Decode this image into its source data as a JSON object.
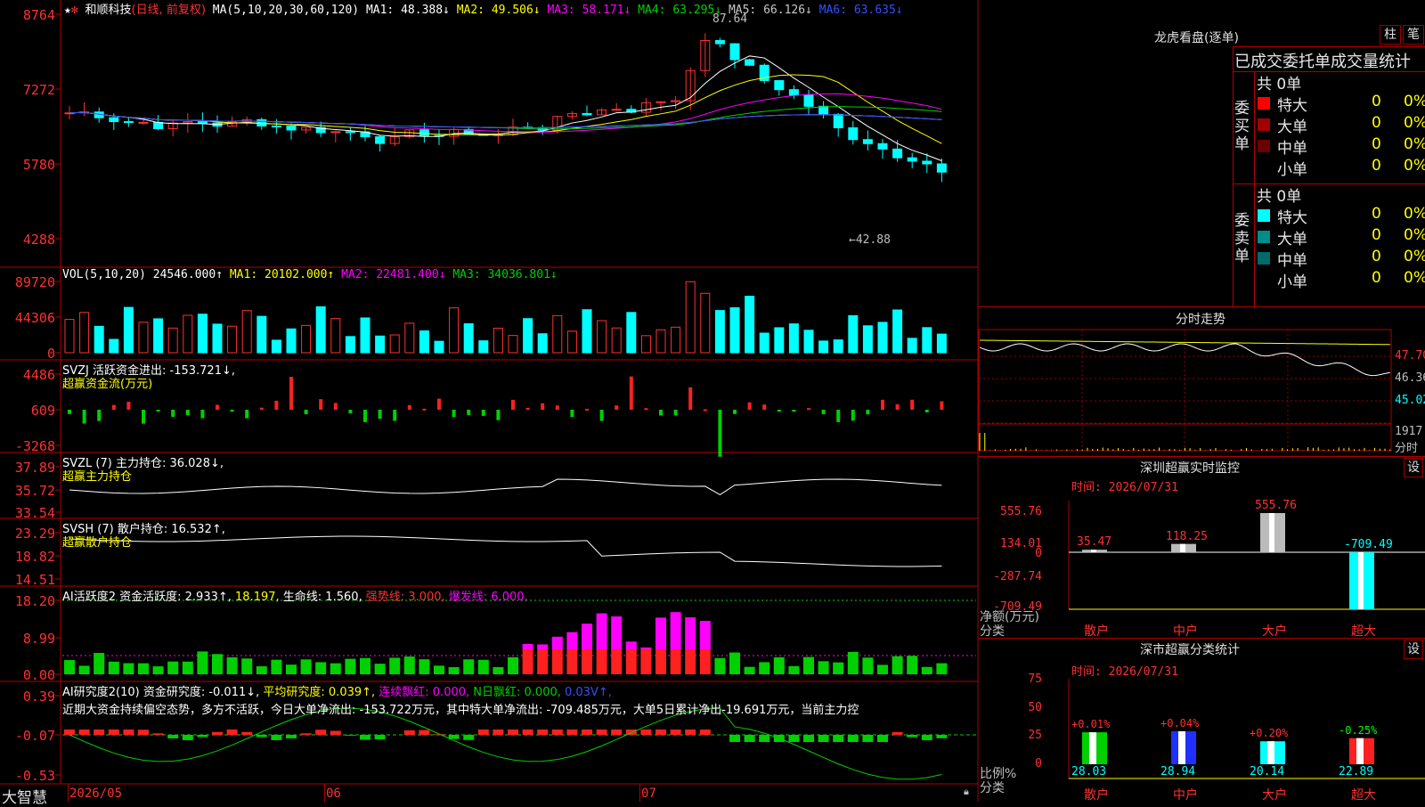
{
  "stock": {
    "name": "和顺科技",
    "period": "(日线, 前复权)"
  },
  "ma_header": {
    "label": "MA(5,10,20,30,60,120)",
    "items": [
      {
        "text": "MA1: 48.388↓",
        "color": "#ffffff"
      },
      {
        "text": "MA2: 49.506↓",
        "color": "#ffff00"
      },
      {
        "text": "MA3: 58.171↓",
        "color": "#ff00ff"
      },
      {
        "text": "MA4: 63.295↓",
        "color": "#00d000"
      },
      {
        "text": "MA5: 66.126↓",
        "color": "#c8c8c8"
      },
      {
        "text": "MA6: 63.635↓",
        "color": "#3050ff"
      }
    ]
  },
  "price_axis": [
    "8764",
    "7272",
    "5780",
    "4288"
  ],
  "price_annotations": {
    "high": "87.64",
    "low": "←42.88"
  },
  "vol_header": {
    "label": "VOL(5,10,20)",
    "items": [
      {
        "text": "24546.000↑",
        "color": "#ffffff"
      },
      {
        "text": "MA1: 20102.000↑",
        "color": "#ffff00"
      },
      {
        "text": "MA2: 22481.400↓",
        "color": "#ff00ff"
      },
      {
        "text": "MA3: 34036.801↓",
        "color": "#00d000"
      }
    ]
  },
  "vol_axis": [
    "89720",
    "44306",
    "0"
  ],
  "svzj": {
    "label": "SVZJ  活跃资金进出: -153.721↓,",
    "sub": "超赢资金流(万元)",
    "axis": [
      "4486",
      "609",
      "-3268"
    ]
  },
  "svzl": {
    "label": "SVZL (7) 主力持仓: 36.028↓,",
    "sub": "超赢主力持仓",
    "axis": [
      "37.89",
      "35.72",
      "33.54"
    ]
  },
  "svsh": {
    "label": "SVSH (7) 散户持仓: 16.532↑,",
    "sub": "超赢散户持仓",
    "axis": [
      "23.29",
      "18.82",
      "14.51"
    ]
  },
  "ai_active": {
    "label": "AI活跃度2 资金活跃度: 2.933↑,",
    "items": [
      {
        "text": "18.197,",
        "color": "#ffff00"
      },
      {
        "text": "生命线: 1.560,",
        "color": "#ffffff"
      },
      {
        "text": "强势线: 3.000,",
        "color": "#ff3030"
      },
      {
        "text": "爆发线: 6.000,",
        "color": "#ff00ff"
      }
    ],
    "axis": [
      "18.20",
      "8.99",
      "0.00"
    ]
  },
  "ai_research": {
    "label": "AI研究度2(10) 资金研究度: -0.011↓,",
    "items": [
      {
        "text": "平均研究度: 0.039↑,",
        "color": "#ffff00"
      },
      {
        "text": "连续飘红: 0.000,",
        "color": "#ff00ff"
      },
      {
        "text": "N日飘红: 0.000,",
        "color": "#00d000"
      },
      {
        "text": "0.03V↑,",
        "color": "#3050ff"
      }
    ],
    "comment": "近期大资金持续偏空态势，多方不活跃，今日大单净流出: -153.722万元，其中特大单净流出: -709.485万元，大单5日累计净出-19.691万元，当前主力控",
    "axis": [
      "0.39",
      "-0.07",
      "-0.53"
    ]
  },
  "bottom_bar": {
    "brand": "大智慧",
    "dates": [
      "2026/05",
      "06",
      "07"
    ]
  },
  "right_panel": {
    "title": "龙虎看盘(逐单)",
    "tab_bar": "柱",
    "tab_line": "笔",
    "heading": "已成交委托单成交量统计",
    "buy": {
      "side_label": "委买单",
      "total": "共 0单",
      "rows": [
        {
          "label": "特大",
          "count": "0",
          "pct": "0%",
          "color": "#ff0000"
        },
        {
          "label": "大单",
          "count": "0",
          "pct": "0%",
          "color": "#a00000"
        },
        {
          "label": "中单",
          "count": "0",
          "pct": "0%",
          "color": "#6a0000"
        },
        {
          "label": "小单",
          "count": "0",
          "pct": "0%",
          "color": ""
        }
      ]
    },
    "sell": {
      "side_label": "委卖单",
      "total": "共 0单",
      "rows": [
        {
          "label": "特大",
          "count": "0",
          "pct": "0%",
          "color": "#00ffff"
        },
        {
          "label": "大单",
          "count": "0",
          "pct": "0%",
          "color": "#008c8c"
        },
        {
          "label": "中单",
          "count": "0",
          "pct": "0%",
          "color": "#006a6a"
        },
        {
          "label": "小单",
          "count": "0",
          "pct": "0%",
          "color": ""
        }
      ]
    },
    "intraday": {
      "title": "分时走势",
      "axis": [
        "47.70",
        "46.36",
        "45.02"
      ],
      "vol_label": "1917",
      "vol_unit": "分时"
    },
    "monitor": {
      "title": "深圳超赢实时监控",
      "settings": "设",
      "time": "时间: 2026/07/31",
      "axis": [
        "555.76",
        "134.01",
        "0",
        "-287.74",
        "-709.49"
      ],
      "ylabel": "净额(万元)",
      "xlabel": "分类"
    },
    "stats": {
      "title": "深市超赢分类统计",
      "settings": "设",
      "time": "时间: 2026/07/31",
      "axis": [
        "75",
        "50",
        "25",
        "0"
      ],
      "ylabel": "比例%",
      "xlabel": "分类"
    }
  },
  "chart_data": [
    {
      "type": "bar",
      "title": "深圳超赢实时监控",
      "ylabel": "净额(万元)",
      "categories": [
        "散户",
        "中户",
        "大户",
        "超大"
      ],
      "values": [
        35.47,
        118.25,
        555.76,
        -709.49
      ],
      "labels": [
        "35.47",
        "118.25",
        "555.76",
        "-709.49"
      ],
      "ylim": [
        -709.49,
        555.76
      ],
      "colors": [
        "#bbbbbb",
        "#bbbbbb",
        "#bbbbbb",
        "#00ffff"
      ],
      "label_colors": [
        "#ff3030",
        "#ff3030",
        "#ff3030",
        "#00ffff"
      ]
    },
    {
      "type": "bar",
      "title": "深市超赢分类统计",
      "ylabel": "比例%",
      "categories": [
        "散户",
        "中户",
        "大户",
        "超大"
      ],
      "values": [
        28.03,
        28.94,
        20.14,
        22.89
      ],
      "labels": [
        "28.03",
        "28.94",
        "20.14",
        "22.89"
      ],
      "changes": [
        "+0.01%",
        "+0.04%",
        "+0.20%",
        "-0.25%"
      ],
      "change_colors": [
        "#ff3030",
        "#ff3030",
        "#ff3030",
        "#00ff00"
      ],
      "ylim": [
        0,
        75
      ],
      "colors": [
        "#00d000",
        "#2030ff",
        "#00ffff",
        "#ff2020"
      ]
    }
  ]
}
